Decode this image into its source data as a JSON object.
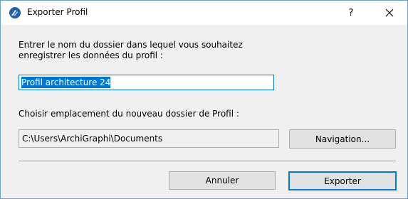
{
  "window": {
    "title": "Exporter Profil",
    "help_label": "?",
    "app_icon": "archicad-logo-icon",
    "close_icon": "close-icon"
  },
  "form": {
    "prompt": "Entrer le nom du dossier dans lequel vous souhaitez\nenregistrer les données du profil :",
    "folder_name_value": "Profil architecture 24",
    "location_label": "Choisir emplacement du nouveau dossier de Profil :",
    "path_value": "C:\\Users\\ArchiGraphi\\Documents",
    "navigation_label": "Navigation..."
  },
  "buttons": {
    "cancel_label": "Annuler",
    "export_label": "Exporter"
  },
  "colors": {
    "accent": "#0078d7",
    "dialog_background": "#f0f0f0",
    "title_background": "#ffffff",
    "button_face": "#e1e1e1"
  }
}
